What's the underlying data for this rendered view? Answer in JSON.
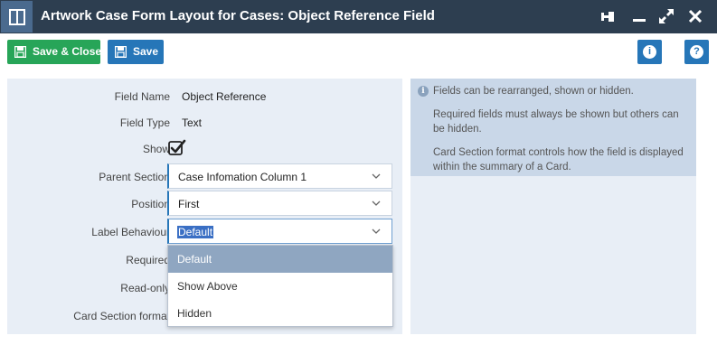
{
  "window": {
    "title": "Artwork Case Form Layout for Cases: Object Reference Field"
  },
  "toolbar": {
    "save_close_label": "Save & Close",
    "save_label": "Save",
    "info_button_glyph": "i",
    "help_button_glyph": "?"
  },
  "form": {
    "field_name_label": "Field Name",
    "field_name_value": "Object Reference",
    "field_type_label": "Field Type",
    "field_type_value": "Text",
    "show_label": "Show",
    "show_checked": true,
    "parent_section_label": "Parent Section",
    "parent_section_value": "Case Infomation Column 1",
    "position_label": "Position",
    "position_value": "First",
    "label_behaviour_label": "Label Behaviour",
    "label_behaviour_value": "Default",
    "required_label": "Required",
    "read_only_label": "Read-only",
    "card_section_format_label": "Card Section format"
  },
  "dropdown": {
    "options": [
      "Default",
      "Show Above",
      "Hidden"
    ],
    "selected_index": 0
  },
  "info": {
    "line1": "Fields can be rearranged, shown or hidden.",
    "line2": "Required fields must always be shown but others can be hidden.",
    "line3": "Card Section format controls how the field is displayed within the summary of a Card."
  },
  "colors": {
    "titlebar": "#2d3e50",
    "save_close": "#27a558",
    "save": "#2676b8",
    "panel": "#e8eef6",
    "info_header": "#c9d7e8",
    "dropdown_selected": "#8fa6c1"
  },
  "icons": [
    "layout-icon",
    "pin-icon",
    "minimize-icon",
    "maximize-icon",
    "close-icon",
    "save-icon",
    "info-icon",
    "help-icon",
    "chevron-down-icon",
    "checkmark-icon"
  ]
}
